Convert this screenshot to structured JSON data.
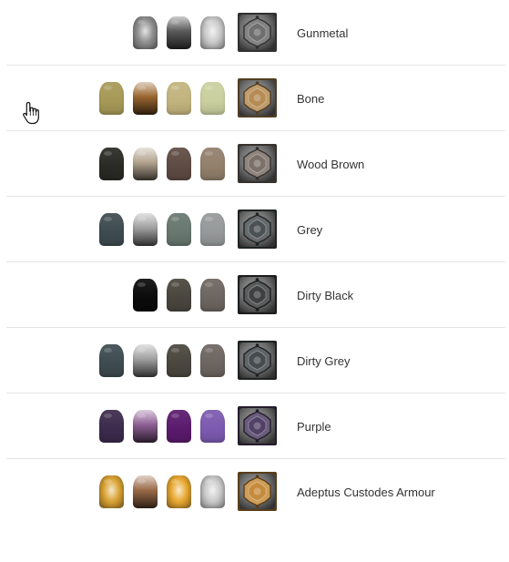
{
  "schemes": [
    {
      "name": "Gunmetal",
      "pots": [
        "#8f8f8f",
        "#5a5a5a",
        "#c9c9c9"
      ],
      "pot_styles": [
        "metal",
        "gradient",
        "metal"
      ],
      "thumb": "#6d6d6d"
    },
    {
      "name": "Bone",
      "pots": [
        "#a69957",
        "#9a6630",
        "#c2b47e",
        "#c9cf9e"
      ],
      "pot_styles": [
        "flat",
        "gradient",
        "flat",
        "flat"
      ],
      "thumb": "#b58a52"
    },
    {
      "name": "Wood Brown",
      "pots": [
        "#292a24",
        "#b3a48f",
        "#5e4b43",
        "#927f6c"
      ],
      "pot_styles": [
        "flat",
        "gradient",
        "flat",
        "flat"
      ],
      "thumb": "#7b6f68"
    },
    {
      "name": "Grey",
      "pots": [
        "#3d4b50",
        "#a0a0a0",
        "#687770",
        "#96999a"
      ],
      "pot_styles": [
        "flat",
        "gradient",
        "flat",
        "flat"
      ],
      "thumb": "#4a5052"
    },
    {
      "name": "Dirty Black",
      "pots": [
        "#0a0a0a",
        "#4a463e",
        "#6d655f"
      ],
      "pot_styles": [
        "flat",
        "flat",
        "flat"
      ],
      "thumb": "#3c3e40"
    },
    {
      "name": "Dirty Grey",
      "pots": [
        "#3d4b50",
        "#a0a0a0",
        "#4a463e",
        "#6d655f"
      ],
      "pot_styles": [
        "flat",
        "gradient",
        "flat",
        "flat"
      ],
      "thumb": "#434a4c"
    },
    {
      "name": "Purple",
      "pots": [
        "#3c2a4c",
        "#8e5f94",
        "#5a1a6c",
        "#7c5ab0"
      ],
      "pot_styles": [
        "flat",
        "gradient",
        "flat",
        "flat"
      ],
      "thumb": "#4f3f64"
    },
    {
      "name": "Adeptus Custodes Armour",
      "pots": [
        "#d9a233",
        "#9a6a48",
        "#e8a830",
        "#c9c9c9"
      ],
      "pot_styles": [
        "metal",
        "gradient",
        "metal",
        "metal"
      ],
      "thumb": "#c58a3a"
    }
  ]
}
